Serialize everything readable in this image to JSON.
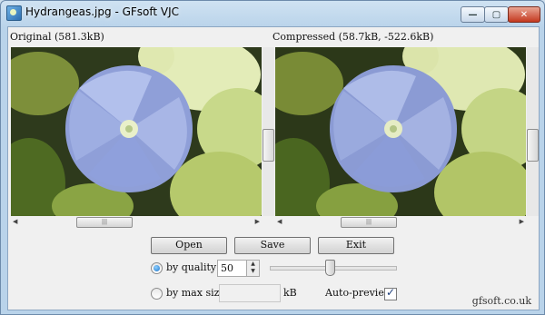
{
  "window": {
    "title": "Hydrangeas.jpg - GFsoft VJC",
    "controls": {
      "minimize": "—",
      "maximize": "▢",
      "close": "✕"
    }
  },
  "original": {
    "label": "Original (581.3kB)"
  },
  "compressed": {
    "label": "Compressed (58.7kB, -522.6kB)"
  },
  "buttons": {
    "open": "Open",
    "save": "Save",
    "exit": "Exit"
  },
  "quality": {
    "label": "by quality",
    "value": "50",
    "selected": true
  },
  "max_size": {
    "label": "by max size",
    "unit": "kB",
    "value": "",
    "selected": false
  },
  "auto_preview": {
    "label": "Auto-preview",
    "checked": true
  },
  "footer": {
    "text": "gfsoft.co.uk"
  },
  "colors": {
    "title_bar": "#b9d3ea",
    "client_bg": "#f0f0f0",
    "radio_accent": "#1d74c9"
  }
}
